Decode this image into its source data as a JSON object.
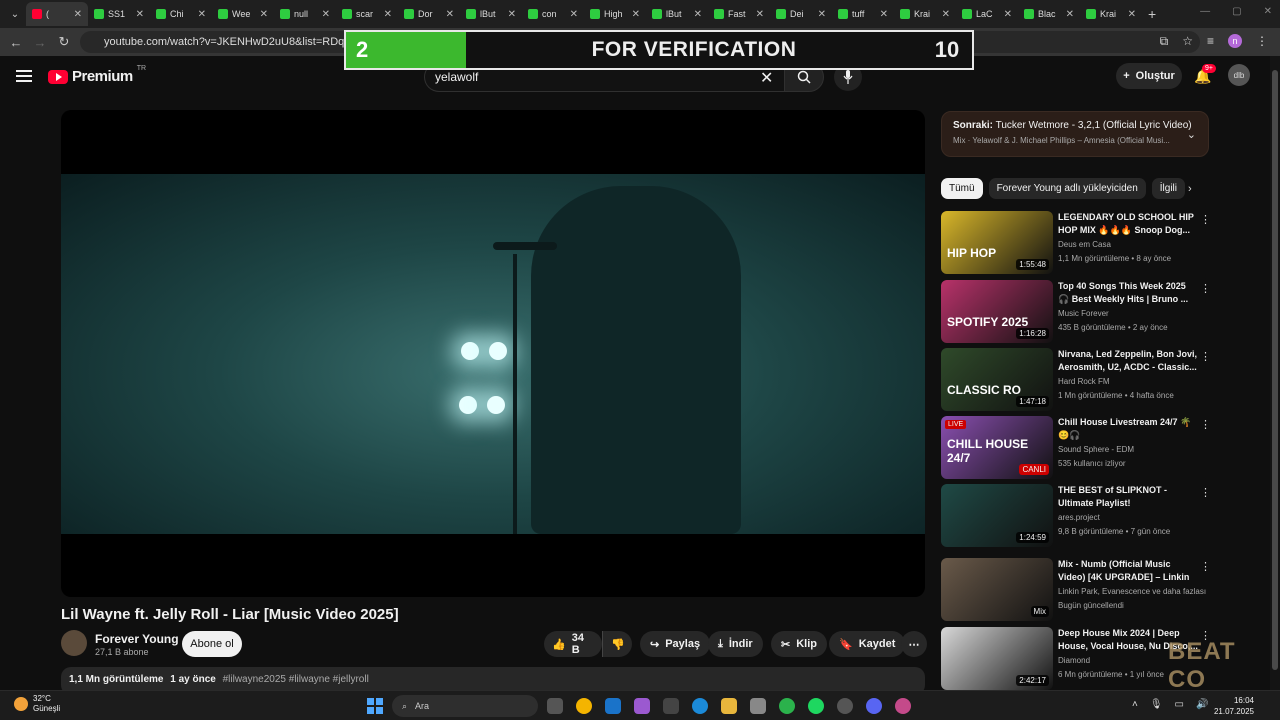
{
  "browser": {
    "tabs": [
      {
        "title": "(",
        "favicon": "youtube",
        "active": true
      },
      {
        "title": "SS1"
      },
      {
        "title": "Chi"
      },
      {
        "title": "Wee"
      },
      {
        "title": "null"
      },
      {
        "title": "scar"
      },
      {
        "title": "Dor"
      },
      {
        "title": "lBut"
      },
      {
        "title": "con"
      },
      {
        "title": "High"
      },
      {
        "title": "lBut"
      },
      {
        "title": "Fast"
      },
      {
        "title": "Dei"
      },
      {
        "title": "tuff"
      },
      {
        "title": "Krai"
      },
      {
        "title": "LaC"
      },
      {
        "title": "Blac"
      },
      {
        "title": "Krai"
      }
    ],
    "url": "youtube.com/watch?v=JKENHwD2uU8&list=RDqkbfJqaoN",
    "profile_initial": "n"
  },
  "overlay": {
    "left_number": "2",
    "text": "FOR VERIFICATION",
    "right_number": "10"
  },
  "youtube": {
    "logo_text": "Premium",
    "region": "TR",
    "search_query": "yelawolf",
    "create_label": "Oluştur",
    "notif_count": "9+",
    "user_initials": "dlb"
  },
  "video": {
    "title": "Lil Wayne ft. Jelly Roll - Liar [Music Video 2025]",
    "channel": "Forever Young",
    "subscribers": "27,1 B abone",
    "subscribe_label": "Abone ol",
    "likes": "34 B",
    "share_label": "Paylaş",
    "download_label": "İndir",
    "clip_label": "Klip",
    "save_label": "Kaydet",
    "views": "1,1 Mn görüntüleme",
    "age": "1 ay önce",
    "hashtags": "#lilwayne2025 #lilwayne #jellyroll"
  },
  "up_next": {
    "label": "Sonraki:",
    "title": "Tucker Wetmore - 3,2,1 (Official Lyric Video)",
    "subtitle": "Mix · Yelawolf & J. Michael Phillips – Amnesia (Official Musi..."
  },
  "chips": [
    "Tümü",
    "Forever Young adlı yükleyiciden",
    "İlgili"
  ],
  "recommendations": [
    {
      "title": "LEGENDARY OLD SCHOOL HIP HOP MIX 🔥🔥🔥 Snoop Dog...",
      "channel": "Deus em Casa",
      "meta": "1,1 Mn görüntüleme • 8 ay önce",
      "duration": "1:55:48",
      "color": "#d9b72a",
      "thumb_text": "HIP HOP"
    },
    {
      "title": "Top 40 Songs This Week 2025 🎧 Best Weekly Hits | Bruno ...",
      "channel": "Music Forever",
      "meta": "435 B görüntüleme • 2 ay önce",
      "duration": "1:16:28",
      "color": "#b8326a",
      "thumb_text": "SPOTIFY 2025"
    },
    {
      "title": "Nirvana, Led Zeppelin, Bon Jovi, Aerosmith, U2, ACDC - Classic...",
      "channel": "Hard Rock FM",
      "meta": "1 Mn görüntüleme • 4 hafta önce",
      "duration": "1:47:18",
      "color": "#2f4a2a",
      "thumb_text": "CLASSIC RO"
    },
    {
      "title": "Chill House Livestream 24/7 🌴😊🎧",
      "channel": "Sound Sphere - EDM",
      "meta": "535 kullanıcı izliyor",
      "duration": "CANLI",
      "color": "#8a4fb0",
      "thumb_text": "CHILL HOUSE 24/7",
      "live_badge": "LIVE"
    },
    {
      "title": "THE BEST of SLIPKNOT - Ultimate Playlist!",
      "channel": "ares.project",
      "meta": "9,8 B görüntüleme • 7 gün önce",
      "duration": "1:24:59",
      "color": "#1f4a46",
      "thumb_text": ""
    },
    {
      "title": "Mix - Numb (Official Music Video) [4K UPGRADE] – Linkin ...",
      "channel": "Linkin Park, Evanescence ve daha fazlası",
      "meta": "Bugün güncellendi",
      "duration": "Mix",
      "color": "#6a5a4a",
      "thumb_text": ""
    },
    {
      "title": "Deep House Mix 2024 | Deep House, Vocal House, Nu Disco,...",
      "channel": "Diamond",
      "meta": "6 Mn görüntüleme • 1 yıl önce",
      "duration": "2:42:17",
      "color": "#d8d8d8",
      "thumb_text": ""
    }
  ],
  "watermark": "BEAT CO",
  "taskbar": {
    "temperature": "32°C",
    "weather": "Güneşli",
    "search_label": "Ara",
    "time": "16:04",
    "date": "21.07.2025"
  }
}
